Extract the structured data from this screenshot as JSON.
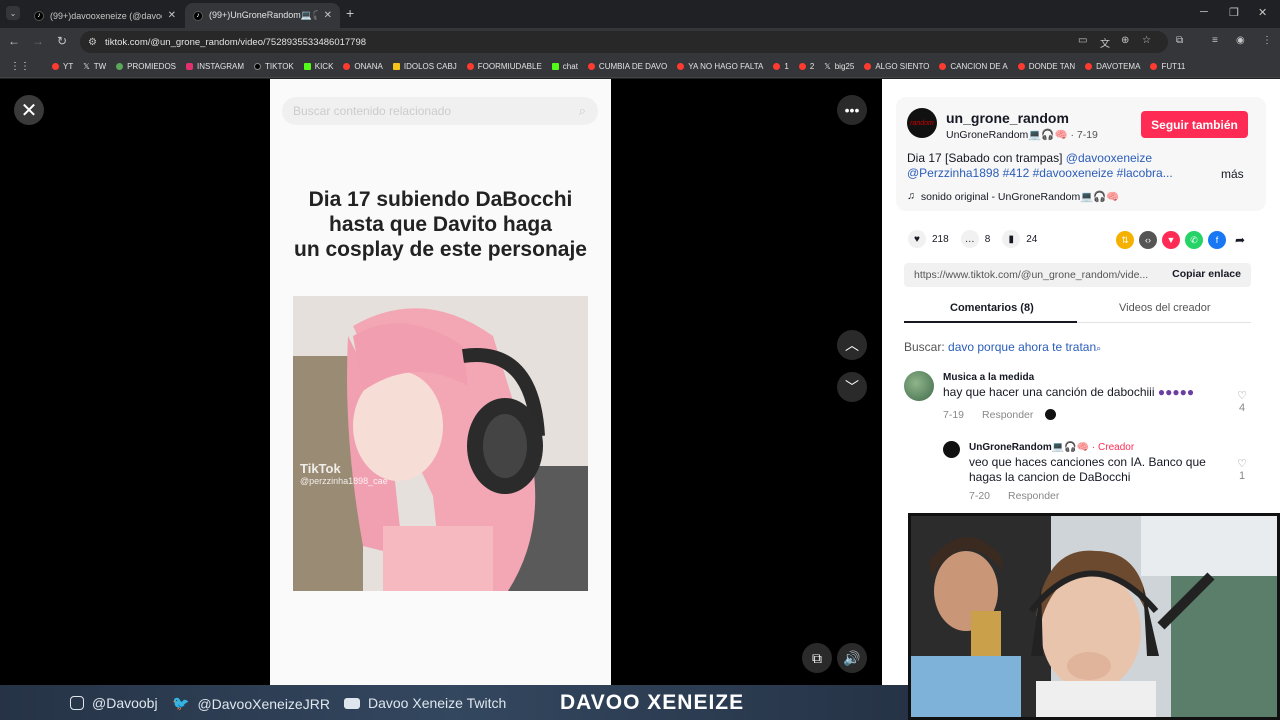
{
  "browser": {
    "tabs": [
      {
        "title": "(99+)davooxeneize (@davooxe",
        "active": false
      },
      {
        "title": "(99+)UnGroneRandom💻🎧🧠 (@",
        "active": true
      }
    ],
    "url": "tiktok.com/@un_grone_random/video/7528935533486017798",
    "bookmarks": [
      "YT",
      "TW",
      "PROMIEDOS",
      "INSTAGRAM",
      "TIKTOK",
      "KICK",
      "ONANA",
      "IDOLOS CABJ",
      "FOORMIUDABLE",
      "chat",
      "CUMBIA DE DAVO",
      "YA NO HAGO FALTA",
      "1",
      "2",
      "big25",
      "ALGO SIENTO",
      "CANCION DE A",
      "DONDE TAN",
      "DAVOTEMA",
      "FUT11"
    ]
  },
  "video": {
    "search_placeholder": "Buscar contenido relacionado",
    "caption_lines": [
      "Dia 17 subiendo DaBocchi",
      "hasta que Davito haga",
      "un cosplay de este personaje"
    ],
    "watermark_brand": "TikTok",
    "watermark_user": "@perzzinha1898_cae"
  },
  "post": {
    "avatar_text": "random",
    "username": "un_grone_random",
    "display_name": "UnGroneRandom💻🎧🧠",
    "date": "· 7-19",
    "follow_label": "Seguir también",
    "desc_plain": "Dia 17 [Sabado con trampas] ",
    "desc_tags": "@davooxeneize @Perzzinha1898 #412 #davooxeneize #lacobra...",
    "more_label": "más",
    "sound": "sonido original - UnGroneRandom💻🎧🧠",
    "likes": "218",
    "comments": "8",
    "saves": "24",
    "link": "https://www.tiktok.com/@un_grone_random/vide...",
    "copy_label": "Copiar enlace",
    "tab_comments": "Comentarios (8)",
    "tab_videos": "Videos del creador",
    "search_prefix": "Buscar:",
    "search_query": "davo porque ahora te tratan"
  },
  "comments": [
    {
      "name": "Musica a la medida",
      "text": "hay que hacer una canción de dabochiii",
      "date": "7-19",
      "reply": "Responder",
      "likes": "4"
    },
    {
      "name": "UnGroneRandom💻🎧🧠",
      "creator": "· Creador",
      "text": "veo que haces canciones con IA. Banco que hagas la cancion de DaBocchi",
      "date": "7-20",
      "reply": "Responder",
      "likes": "1"
    }
  ],
  "footer": {
    "instagram": "@Davoobj",
    "twitter": "@DavooXeneizeJRR",
    "youtube": "Davoo Xeneize Twitch",
    "brand": "DAVOO XENEIZE"
  }
}
